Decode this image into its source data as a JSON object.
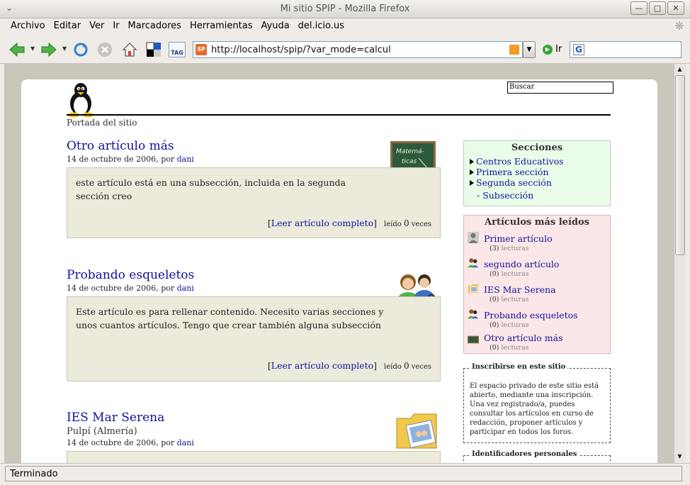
{
  "window": {
    "title": "Mi sitio SPIP - Mozilla Firefox"
  },
  "menu": [
    "Archivo",
    "Editar",
    "Ver",
    "Ir",
    "Marcadores",
    "Herramientas",
    "Ayuda",
    "del.icio.us"
  ],
  "toolbar": {
    "url": "http://localhost/spip/?var_mode=calcul",
    "go_label": "Ir",
    "tag_label": "TAG"
  },
  "page": {
    "search_value": "Buscar",
    "breadcrumb": "Portada del sitio",
    "articles": [
      {
        "title": "Otro artículo más",
        "date": "14 de octubre de 2006,",
        "by": "por",
        "author": "dani",
        "text": "este artículo está en una subsección, incluida en la segunda sección creo",
        "read_more": "Leer artículo completo",
        "leido_pre": "leído",
        "leido_count": "0",
        "leido_post": "veces",
        "logo": "pizarra-matematicas",
        "logo_text": "Matemá-ticas"
      },
      {
        "title": "Probando esqueletos",
        "date": "14 de octubre de 2006,",
        "by": "por",
        "author": "dani",
        "text": "Este artículo es para rellenar contenido. Necesito varias secciones y unos cuantos artículos. Tengo que crear también alguna subsección",
        "read_more": "Leer artículo completo",
        "leido_pre": "leído",
        "leido_count": "0",
        "leido_post": "veces",
        "logo": "users-lock-icon"
      },
      {
        "title": "IES Mar Serena",
        "subtitle": "Pulpí (Almería)",
        "date": "14 de octubre de 2006,",
        "by": "por",
        "author": "dani",
        "logo": "folder-photos-icon"
      }
    ],
    "sidebar": {
      "secciones_title": "Secciones",
      "secciones": [
        "Centros Educativos",
        "Primera sección",
        "Segunda sección"
      ],
      "subseccion": "- Subsección",
      "mas_leidos_title": "Artículos más leídos",
      "mas_leidos": [
        {
          "title": "Primer artículo",
          "count": "(3)",
          "unit": "lecturas",
          "icon": "person-icon"
        },
        {
          "title": "segundo artículo",
          "count": "(0)",
          "unit": "lecturas",
          "icon": "users-icon"
        },
        {
          "title": "IES Mar Serena",
          "count": "(0)",
          "unit": "lecturas",
          "icon": "folder-icon"
        },
        {
          "title": "Probando esqueletos",
          "count": "(0)",
          "unit": "lecturas",
          "icon": "users-icon"
        },
        {
          "title": "Otro artículo más",
          "count": "(0)",
          "unit": "lecturas",
          "icon": "blackboard-icon"
        }
      ],
      "inscribirse_title": "Inscribirse en este sitio",
      "inscribirse_text": "El espacio privado de este sitio está abierto, mediante una inscripción. Una vez registrado/a, puedes consultar los artículos en curso de redacción, proponer artículos y participar en todos los foros.",
      "identificadores_title": "Identificadores personales"
    }
  },
  "status": {
    "text": "Terminado"
  }
}
